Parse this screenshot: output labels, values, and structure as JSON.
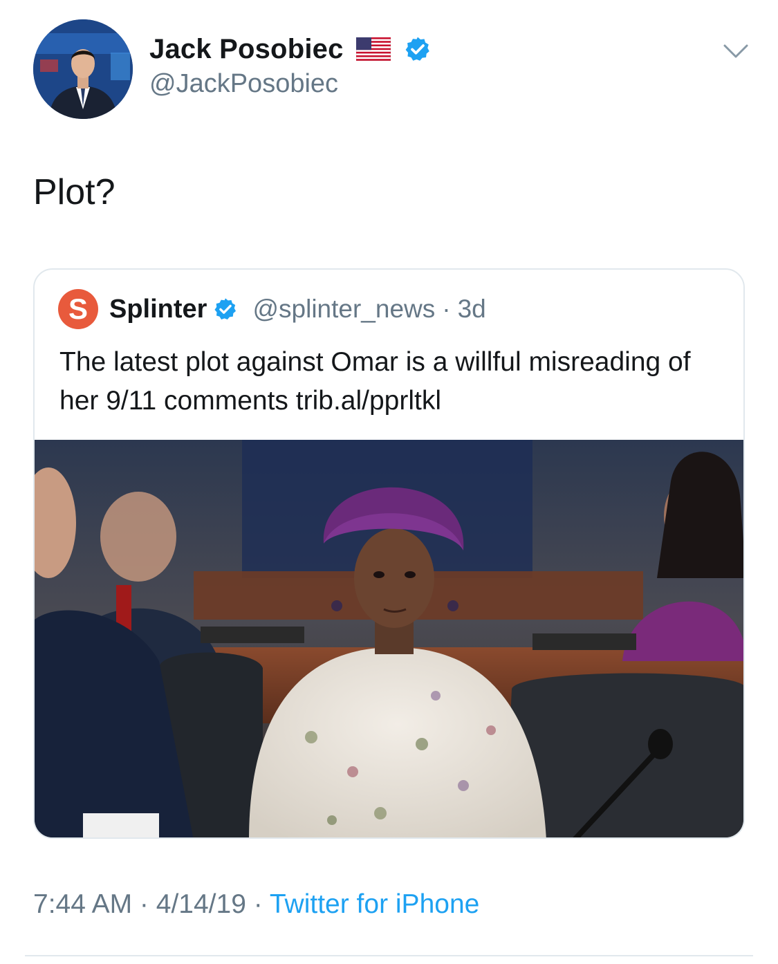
{
  "author": {
    "display_name": "Jack Posobiec",
    "handle": "@JackPosobiec",
    "flag_icon": "us-flag-icon",
    "verified_icon": "verified-badge-icon"
  },
  "tweet": {
    "text": "Plot?"
  },
  "quoted": {
    "logo_letter": "S",
    "logo_color": "#e85a3c",
    "name": "Splinter",
    "handle": "@splinter_news",
    "separator": "·",
    "time": "3d",
    "text": "The latest plot against Omar is a willful misreading of her 9/11 comments trib.al/pprltkl"
  },
  "meta": {
    "time": "7:44 AM",
    "sep1": " · ",
    "date": "4/14/19",
    "sep2": " · ",
    "source": "Twitter for iPhone"
  },
  "colors": {
    "link": "#1da1f2",
    "secondary": "#657786",
    "verified": "#1da1f2"
  }
}
